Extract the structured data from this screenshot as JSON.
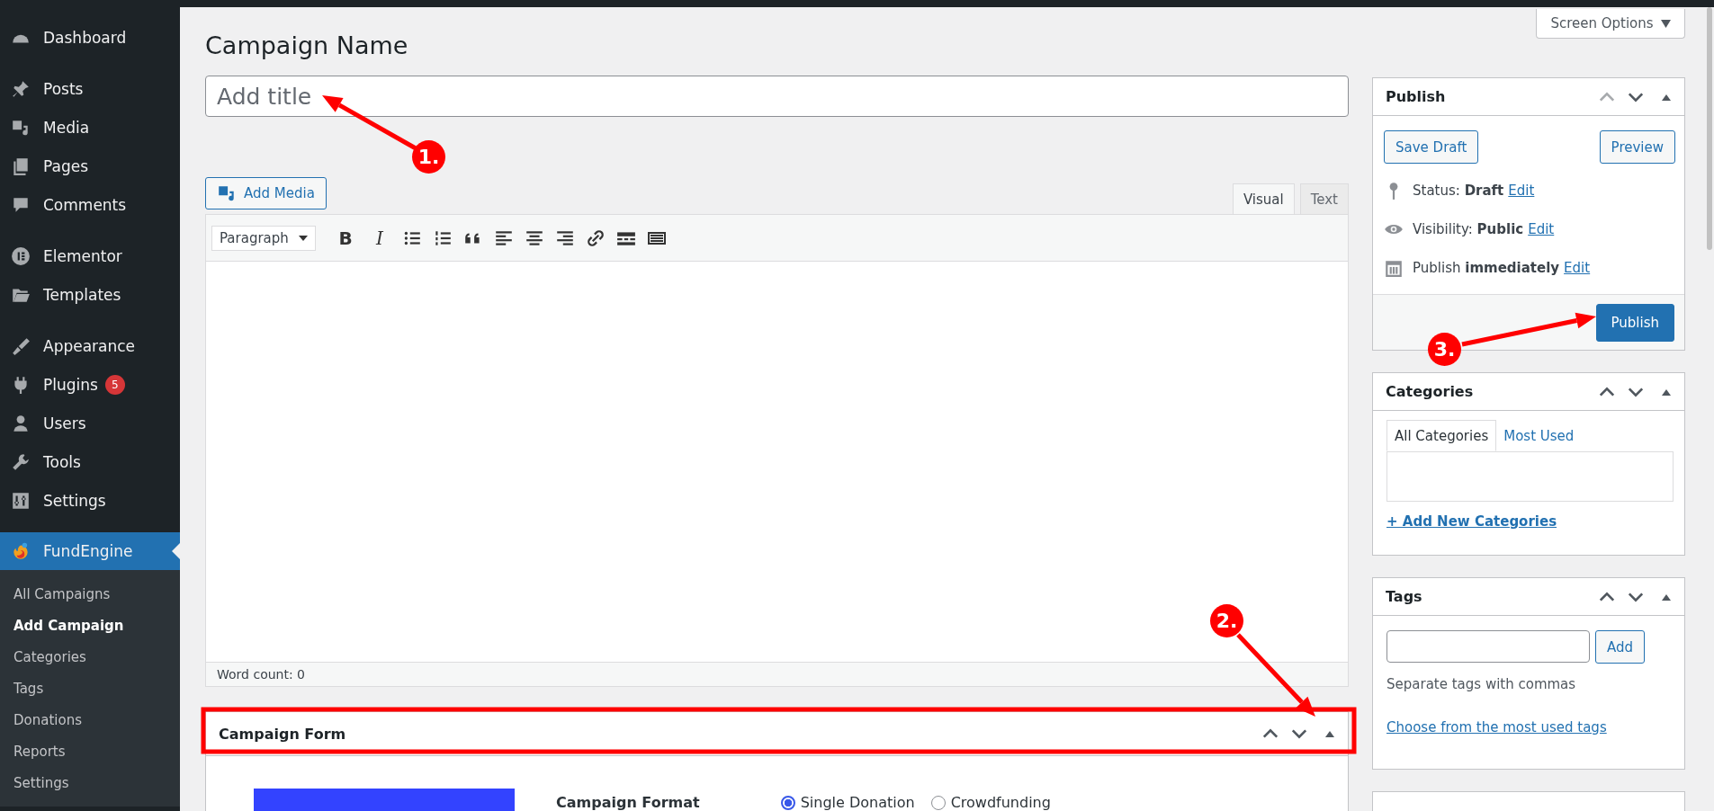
{
  "sidebar": {
    "groups": [
      {
        "items": [
          {
            "label": "Dashboard",
            "selected": false
          }
        ]
      },
      {
        "items": [
          {
            "label": "Posts",
            "selected": false
          },
          {
            "label": "Media",
            "selected": false
          },
          {
            "label": "Pages",
            "selected": false
          },
          {
            "label": "Comments",
            "selected": false
          }
        ]
      },
      {
        "items": [
          {
            "label": "Elementor",
            "selected": false
          },
          {
            "label": "Templates",
            "selected": false
          }
        ]
      },
      {
        "items": [
          {
            "label": "Appearance",
            "selected": false
          },
          {
            "label": "Plugins",
            "selected": false,
            "badge": "5"
          },
          {
            "label": "Users",
            "selected": false
          },
          {
            "label": "Tools",
            "selected": false
          },
          {
            "label": "Settings",
            "selected": false
          }
        ]
      },
      {
        "items": [
          {
            "label": "FundEngine",
            "selected": true,
            "children": [
              {
                "label": "All Campaigns",
                "selected": false
              },
              {
                "label": "Add Campaign",
                "selected": true
              },
              {
                "label": "Categories",
                "selected": false
              },
              {
                "label": "Tags",
                "selected": false
              },
              {
                "label": "Donations",
                "selected": false
              },
              {
                "label": "Reports",
                "selected": false
              },
              {
                "label": "Settings",
                "selected": false
              }
            ]
          }
        ]
      }
    ]
  },
  "screen_options": "Screen Options",
  "page_title": "Campaign Name",
  "title_field": {
    "placeholder": "Add title"
  },
  "add_media_button": "Add Media",
  "editor_tabs": [
    {
      "label": "Visual",
      "selected": true
    },
    {
      "label": "Text",
      "selected": false
    }
  ],
  "toolbar": {
    "format": "Paragraph",
    "bold": "B",
    "italic": "I"
  },
  "word_count": "Word count: 0",
  "campaign_form": {
    "title": "Campaign Form",
    "field_label": "Campaign Format",
    "options": [
      {
        "label": "Single Donation",
        "selected": true
      },
      {
        "label": "Crowdfunding",
        "selected": false
      }
    ]
  },
  "publish": {
    "title": "Publish",
    "save_draft": "Save Draft",
    "preview": "Preview",
    "rows": [
      {
        "label": "Status:",
        "value": "Draft",
        "link": "Edit"
      },
      {
        "label": "Visibility:",
        "value": "Public",
        "link": "Edit"
      },
      {
        "label": "Publish",
        "value": "immediately",
        "link": "Edit"
      }
    ],
    "button": "Publish"
  },
  "categories": {
    "title": "Categories",
    "tabs": [
      {
        "label": "All Categories",
        "selected": true
      },
      {
        "label": "Most Used",
        "selected": false
      }
    ],
    "add_link": "+ Add New Categories"
  },
  "tags": {
    "title": "Tags",
    "add_button": "Add",
    "hint": "Separate tags with commas",
    "link": "Choose from the most used tags"
  },
  "annotations": [
    {
      "label": "1."
    },
    {
      "label": "2."
    },
    {
      "label": "3."
    }
  ]
}
